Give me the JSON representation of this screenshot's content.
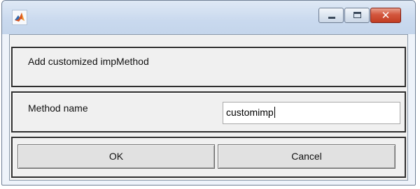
{
  "window": {
    "icon": "matlab-icon",
    "controls": {
      "minimize": "minimize-icon",
      "maximize": "maximize-icon",
      "close": "close-icon"
    }
  },
  "header": {
    "text": "Add customized impMethod"
  },
  "form": {
    "method_name_label": "Method name",
    "method_name_value": "customimp"
  },
  "buttons": {
    "ok": "OK",
    "cancel": "Cancel"
  },
  "colors": {
    "close_button": "#c94a32",
    "titlebar": "#c9d9ee",
    "panel": "#f0f0f0"
  }
}
